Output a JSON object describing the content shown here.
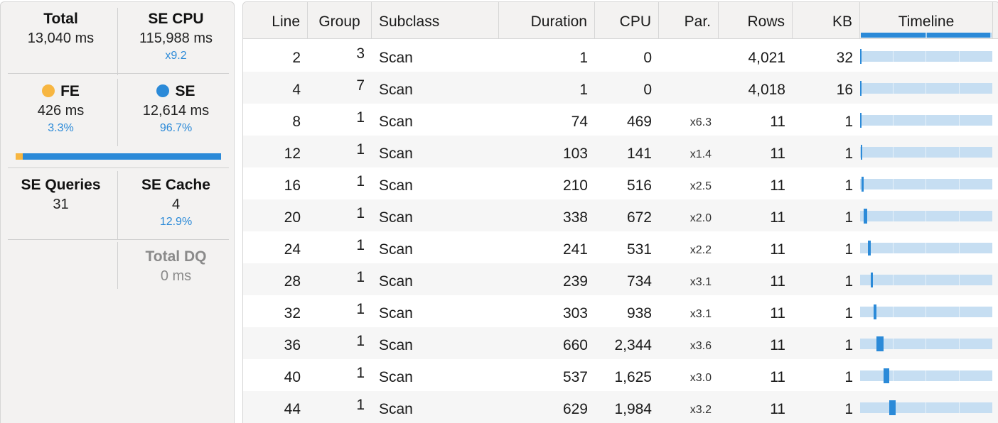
{
  "summary": {
    "total": {
      "label": "Total",
      "value": "13,040 ms"
    },
    "se_cpu": {
      "label": "SE CPU",
      "value": "115,988 ms",
      "sub": "x9.2"
    },
    "fe": {
      "label": "FE",
      "value": "426 ms",
      "sub": "3.3%",
      "color": "#f7b641"
    },
    "se": {
      "label": "SE",
      "value": "12,614 ms",
      "sub": "96.7%",
      "color": "#2b8ad8"
    },
    "fe_share": 0.033,
    "se_queries": {
      "label": "SE Queries",
      "value": "31"
    },
    "se_cache": {
      "label": "SE Cache",
      "value": "4",
      "sub": "12.9%"
    },
    "total_dq": {
      "label": "Total DQ",
      "value": "0 ms"
    }
  },
  "table": {
    "columns": {
      "line": "Line",
      "group": "Group",
      "subclass": "Subclass",
      "duration": "Duration",
      "cpu": "CPU",
      "par": "Par.",
      "rows": "Rows",
      "kb": "KB",
      "timeline": "Timeline"
    },
    "rows": [
      {
        "line": "2",
        "group": "3",
        "subclass": "Scan",
        "duration": "1",
        "cpu": "0",
        "par": "",
        "rows": "4,021",
        "kb": "32",
        "timeline_start": 0.0,
        "timeline_end": 0.008
      },
      {
        "line": "4",
        "group": "7",
        "subclass": "Scan",
        "duration": "1",
        "cpu": "0",
        "par": "",
        "rows": "4,018",
        "kb": "16",
        "timeline_start": 0.0,
        "timeline_end": 0.008
      },
      {
        "line": "8",
        "group": "1",
        "subclass": "Scan",
        "duration": "74",
        "cpu": "469",
        "par": "x6.3",
        "rows": "11",
        "kb": "1",
        "timeline_start": 0.0,
        "timeline_end": 0.01
      },
      {
        "line": "12",
        "group": "1",
        "subclass": "Scan",
        "duration": "103",
        "cpu": "141",
        "par": "x1.4",
        "rows": "11",
        "kb": "1",
        "timeline_start": 0.005,
        "timeline_end": 0.015
      },
      {
        "line": "16",
        "group": "1",
        "subclass": "Scan",
        "duration": "210",
        "cpu": "516",
        "par": "x2.5",
        "rows": "11",
        "kb": "1",
        "timeline_start": 0.012,
        "timeline_end": 0.027
      },
      {
        "line": "20",
        "group": "1",
        "subclass": "Scan",
        "duration": "338",
        "cpu": "672",
        "par": "x2.0",
        "rows": "11",
        "kb": "1",
        "timeline_start": 0.028,
        "timeline_end": 0.054
      },
      {
        "line": "24",
        "group": "1",
        "subclass": "Scan",
        "duration": "241",
        "cpu": "531",
        "par": "x2.2",
        "rows": "11",
        "kb": "1",
        "timeline_start": 0.06,
        "timeline_end": 0.078
      },
      {
        "line": "28",
        "group": "1",
        "subclass": "Scan",
        "duration": "239",
        "cpu": "734",
        "par": "x3.1",
        "rows": "11",
        "kb": "1",
        "timeline_start": 0.08,
        "timeline_end": 0.098
      },
      {
        "line": "32",
        "group": "1",
        "subclass": "Scan",
        "duration": "303",
        "cpu": "938",
        "par": "x3.1",
        "rows": "11",
        "kb": "1",
        "timeline_start": 0.1,
        "timeline_end": 0.123
      },
      {
        "line": "36",
        "group": "1",
        "subclass": "Scan",
        "duration": "660",
        "cpu": "2,344",
        "par": "x3.6",
        "rows": "11",
        "kb": "1",
        "timeline_start": 0.125,
        "timeline_end": 0.176
      },
      {
        "line": "40",
        "group": "1",
        "subclass": "Scan",
        "duration": "537",
        "cpu": "1,625",
        "par": "x3.0",
        "rows": "11",
        "kb": "1",
        "timeline_start": 0.178,
        "timeline_end": 0.219
      },
      {
        "line": "44",
        "group": "1",
        "subclass": "Scan",
        "duration": "629",
        "cpu": "1,984",
        "par": "x3.2",
        "rows": "11",
        "kb": "1",
        "timeline_start": 0.22,
        "timeline_end": 0.268
      }
    ]
  }
}
